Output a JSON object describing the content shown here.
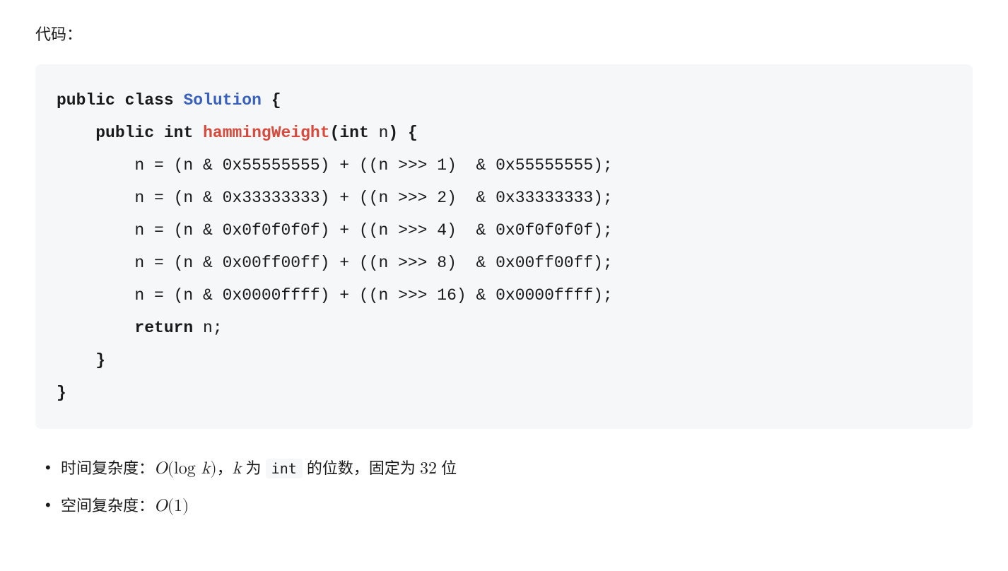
{
  "heading": "代码：",
  "code": {
    "line1": {
      "kw1": "public",
      "kw2": "class",
      "cls": "Solution",
      "brace": "{"
    },
    "line2": {
      "kw1": "public",
      "type": "int",
      "fn": "hammingWeight",
      "l": "(",
      "ptype": "int",
      "pv": " n",
      "r": ")",
      "brace": " {"
    },
    "line3": "        n = (n & 0x55555555) + ((n >>> 1)  & 0x55555555);",
    "line4": "        n = (n & 0x33333333) + ((n >>> 2)  & 0x33333333);",
    "line5": "        n = (n & 0x0f0f0f0f) + ((n >>> 4)  & 0x0f0f0f0f);",
    "line6": "        n = (n & 0x00ff00ff) + ((n >>> 8)  & 0x00ff00ff);",
    "line7": "        n = (n & 0x0000ffff) + ((n >>> 16) & 0x0000ffff);",
    "line8": {
      "kw": "return",
      "rest": " n;"
    },
    "line9": "    }",
    "line10": "}"
  },
  "bullets": {
    "time": {
      "label": "时间复杂度：",
      "bigO_open": "O",
      "bigO_paren_l": "(",
      "log": "log ",
      "k": "k",
      "bigO_paren_r": ")",
      "comma": "，",
      "k2": "k",
      "wei": " 为 ",
      "code": "int",
      "rest1": " 的位数，固定为 ",
      "num": "32",
      "rest2": " 位"
    },
    "space": {
      "label": "空间复杂度：",
      "bigO_open": "O",
      "bigO_paren_l": "(",
      "one": "1",
      "bigO_paren_r": ")"
    }
  }
}
